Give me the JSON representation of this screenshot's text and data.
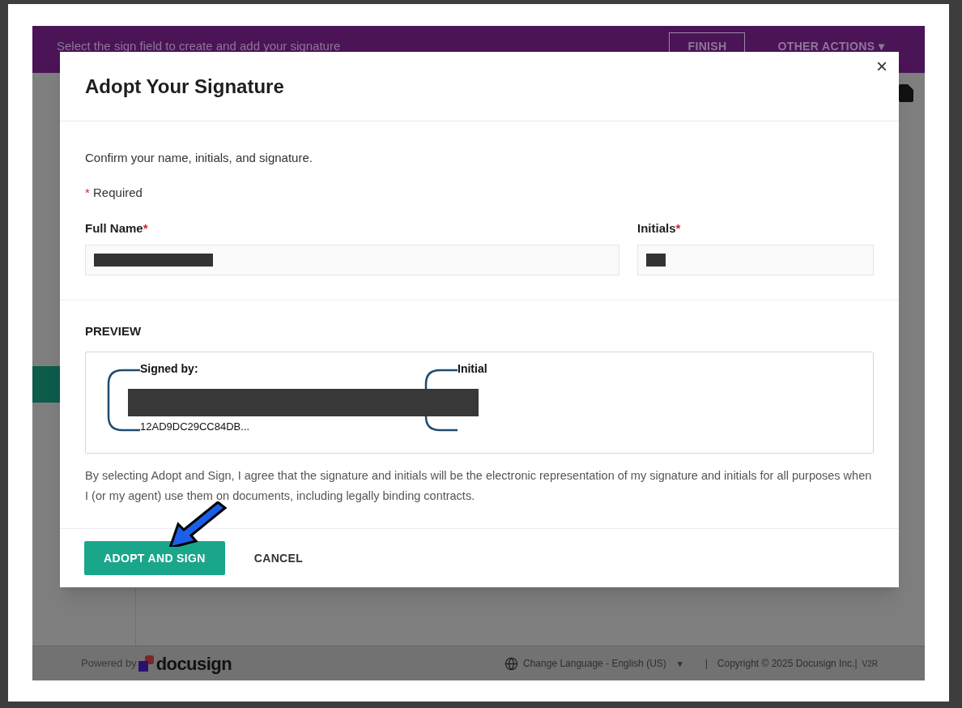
{
  "background_page": {
    "banner_text": "Select the sign field to create and add your signature",
    "finish_button": "FINISH",
    "other_actions_button": "OTHER ACTIONS ▾"
  },
  "dialog": {
    "title": "Adopt Your Signature",
    "close": "×",
    "intro": "Confirm your name, initials, and signature.",
    "required_mark": "*",
    "required_note": "Required",
    "fields": [
      {
        "label": "Full Name",
        "required": true
      },
      {
        "label": "Initials",
        "required": true
      }
    ],
    "preview": {
      "heading": "PREVIEW",
      "signed_by": "Signed by:",
      "signature_id": "12AD9DC29CC84DB...",
      "initial": "Initial"
    },
    "agreement": "By selecting Adopt and Sign, I agree that the signature and initials will be the electronic representation of my signature and initials for all purposes when I (or my agent) use them on documents, including legally binding contracts.",
    "buttons": [
      {
        "label": "ADOPT AND SIGN",
        "kind": "primary"
      },
      {
        "label": "CANCEL",
        "kind": "secondary"
      }
    ]
  },
  "footer": {
    "powered_by": "Powered by",
    "brand": "docusign",
    "language": "Change Language - English (US)",
    "language_caret": "▼",
    "separator": "|",
    "copyright": "Copyright © 2025 Docusign Inc.|",
    "version": "V2R"
  }
}
